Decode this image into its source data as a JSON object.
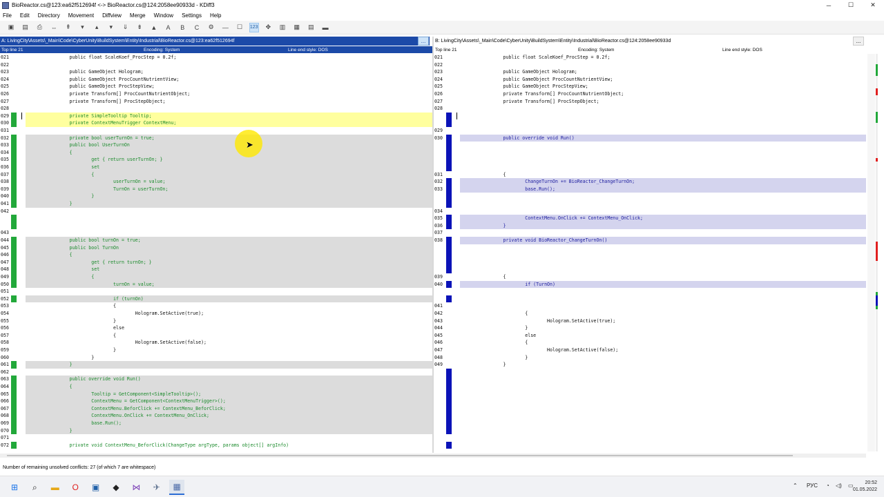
{
  "title": "BioReactor.cs@123:ea62f512694f <-> BioReactor.cs@124:2058ee90933d - KDiff3",
  "window_controls": {
    "minimize": "─",
    "maximize": "☐",
    "close": "✕"
  },
  "menu": [
    "File",
    "Edit",
    "Directory",
    "Movement",
    "Diffview",
    "Merge",
    "Window",
    "Settings",
    "Help"
  ],
  "toolbar_icons": [
    "open-icon",
    "save-icon",
    "print-icon",
    "goto-current-icon",
    "goto-first-delta-icon",
    "goto-prev-delta-icon",
    "goto-up-icon",
    "goto-down-icon",
    "goto-next-delta-icon",
    "goto-last-delta-icon",
    "goto-prev-conflict-icon",
    "goto-next-conflict-icon",
    "select-a-icon",
    "select-b-icon",
    "select-c-icon",
    "auto-merge-icon",
    "whitespace-icon",
    "line-numbers-icon",
    "show-windows-icon",
    "split-icon",
    "split-vertical-icon",
    "word-wrap-icon",
    "overview-icon"
  ],
  "toolbar_glyphs": [
    "▣",
    "▤",
    "⎙",
    "⇔",
    "⇞",
    "▾",
    "▴",
    "▾",
    "⇓",
    "⇟",
    "▲",
    "A",
    "B",
    "C",
    "⚙",
    "—",
    "☐",
    "123",
    "✥",
    "▥",
    "▦",
    "▤",
    "▬"
  ],
  "toolbar_selected": 17,
  "paneA": {
    "path": "A: LivingCity\\Assets\\_Main\\Code\\CyberUnity\\BuildSystem\\Entity\\Industrial\\BioReactor.cs@123:ea62f512694f",
    "browse": "...",
    "topline": "Top line 21",
    "encoding": "Encoding: System",
    "line_end": "Line end style: DOS",
    "lines": [
      {
        "n": "021",
        "t": "                public float ScaleKoef_ProcStep = 0.2f;"
      },
      {
        "n": "022",
        "t": ""
      },
      {
        "n": "023",
        "t": "                public GameObject Hologram;"
      },
      {
        "n": "024",
        "t": "                public GameObject ProcCountNutrientView;"
      },
      {
        "n": "025",
        "t": "                public GameObject ProcStepView;"
      },
      {
        "n": "026",
        "t": "                private Transform[] ProcCountNutrientObject;"
      },
      {
        "n": "027",
        "t": "                private Transform[] ProcStepObject;"
      },
      {
        "n": "028",
        "t": ""
      },
      {
        "n": "029",
        "t": "                private SimpleTooltip Tooltip;",
        "m": "g",
        "h": "y",
        "c": 1
      },
      {
        "n": "030",
        "t": "                private ContextMenuTrigger ContextMenu;",
        "m": "g",
        "h": "y",
        "c": 1
      },
      {
        "n": "031",
        "t": ""
      },
      {
        "n": "032",
        "t": "                private bool userTurnOn = true;",
        "m": "g",
        "h": "gr",
        "c": 1
      },
      {
        "n": "033",
        "t": "                public bool UserTurnOn",
        "m": "g",
        "h": "gr",
        "c": 1
      },
      {
        "n": "034",
        "t": "                {",
        "m": "g",
        "h": "gr",
        "c": 1
      },
      {
        "n": "035",
        "t": "                        get { return userTurnOn; }",
        "m": "g",
        "h": "gr",
        "c": 1
      },
      {
        "n": "036",
        "t": "                        set",
        "m": "g",
        "h": "gr",
        "c": 1
      },
      {
        "n": "037",
        "t": "                        {",
        "m": "g",
        "h": "gr",
        "c": 1
      },
      {
        "n": "038",
        "t": "                                userTurnOn = value;",
        "m": "g",
        "h": "gr",
        "c": 1
      },
      {
        "n": "039",
        "t": "                                TurnOn = userTurnOn;",
        "m": "g",
        "h": "gr",
        "c": 1
      },
      {
        "n": "040",
        "t": "                        }",
        "m": "g",
        "h": "gr",
        "c": 1
      },
      {
        "n": "041",
        "t": "                }",
        "m": "g",
        "h": "gr",
        "c": 1
      },
      {
        "n": "042",
        "t": ""
      },
      {
        "n": "",
        "t": "",
        "m": "g"
      },
      {
        "n": "",
        "t": "",
        "m": "g"
      },
      {
        "n": "043",
        "t": ""
      },
      {
        "n": "044",
        "t": "                public bool turnOn = true;",
        "m": "g",
        "h": "gr",
        "c": 1
      },
      {
        "n": "045",
        "t": "                public bool TurnOn",
        "m": "g",
        "h": "gr",
        "c": 1
      },
      {
        "n": "046",
        "t": "                {",
        "m": "g",
        "h": "gr",
        "c": 1
      },
      {
        "n": "047",
        "t": "                        get { return turnOn; }",
        "m": "g",
        "h": "gr",
        "c": 1
      },
      {
        "n": "048",
        "t": "                        set",
        "m": "g",
        "h": "gr",
        "c": 1
      },
      {
        "n": "049",
        "t": "                        {",
        "m": "g",
        "h": "gr",
        "c": 1
      },
      {
        "n": "050",
        "t": "                                turnOn = value;",
        "m": "g",
        "h": "gr",
        "c": 1
      },
      {
        "n": "051",
        "t": ""
      },
      {
        "n": "052",
        "t": "                                if (turnOn)",
        "m": "g",
        "h": "gr",
        "c": 1
      },
      {
        "n": "053",
        "t": "                                {"
      },
      {
        "n": "054",
        "t": "                                        Hologram.SetActive(true);"
      },
      {
        "n": "055",
        "t": "                                }"
      },
      {
        "n": "056",
        "t": "                                else"
      },
      {
        "n": "057",
        "t": "                                {"
      },
      {
        "n": "058",
        "t": "                                        Hologram.SetActive(false);"
      },
      {
        "n": "059",
        "t": "                                }"
      },
      {
        "n": "060",
        "t": "                        }"
      },
      {
        "n": "061",
        "t": "                }",
        "m": "g",
        "h": "gr",
        "c": 1
      },
      {
        "n": "062",
        "t": ""
      },
      {
        "n": "063",
        "t": "                public override void Run()",
        "m": "g",
        "h": "gr",
        "c": 1
      },
      {
        "n": "064",
        "t": "                {",
        "m": "g",
        "h": "gr",
        "c": 1
      },
      {
        "n": "065",
        "t": "                        Tooltip = GetComponent<SimpleTooltip>();",
        "m": "g",
        "h": "gr",
        "c": 1
      },
      {
        "n": "066",
        "t": "                        ContextMenu = GetComponent<ContextMenuTrigger>();",
        "m": "g",
        "h": "gr",
        "c": 1
      },
      {
        "n": "067",
        "t": "                        ContextMenu.BeforClick += ContextMenu_BeforClick;",
        "m": "g",
        "h": "gr",
        "c": 1
      },
      {
        "n": "068",
        "t": "                        ContextMenu.OnClick += ContextMenu_OnClick;",
        "m": "g",
        "h": "gr",
        "c": 1
      },
      {
        "n": "069",
        "t": "                        base.Run();",
        "m": "g",
        "h": "gr",
        "c": 1
      },
      {
        "n": "070",
        "t": "                }",
        "m": "g",
        "h": "gr",
        "c": 1
      },
      {
        "n": "071",
        "t": ""
      },
      {
        "n": "072",
        "t": "                private void ContextMenu_BeforClick(ChangeType argType, params object[] argInfo)",
        "m": "g",
        "c": 1
      }
    ]
  },
  "paneB": {
    "path": "B: LivingCity\\Assets\\_Main\\Code\\CyberUnity\\BuildSystem\\Entity\\Industrial\\BioReactor.cs@124:2058ee90933d",
    "browse": "...",
    "topline": "Top line 21",
    "encoding": "Encoding: System",
    "line_end": "Line end style: DOS",
    "lines": [
      {
        "n": "021",
        "t": "                public float ScaleKoef_ProcStep = 0.2f;"
      },
      {
        "n": "022",
        "t": ""
      },
      {
        "n": "023",
        "t": "                public GameObject Hologram;"
      },
      {
        "n": "024",
        "t": "                public GameObject ProcCountNutrientView;"
      },
      {
        "n": "025",
        "t": "                public GameObject ProcStepView;"
      },
      {
        "n": "026",
        "t": "                private Transform[] ProcCountNutrientObject;"
      },
      {
        "n": "027",
        "t": "                private Transform[] ProcStepObject;"
      },
      {
        "n": "028",
        "t": ""
      },
      {
        "n": "",
        "t": "",
        "m": "b"
      },
      {
        "n": "",
        "t": "",
        "m": "b"
      },
      {
        "n": "029",
        "t": ""
      },
      {
        "n": "030",
        "t": "                public override void Run()",
        "m": "b",
        "h": "lb",
        "c": 1
      },
      {
        "n": "",
        "t": "",
        "m": "b"
      },
      {
        "n": "",
        "t": "",
        "m": "b"
      },
      {
        "n": "",
        "t": "",
        "m": "b"
      },
      {
        "n": "",
        "t": "",
        "m": "b"
      },
      {
        "n": "031",
        "t": "                {"
      },
      {
        "n": "032",
        "t": "                        ChangeTurnOn += BioReactor_ChangeTurnOn;",
        "m": "b",
        "h": "lb",
        "c": 1
      },
      {
        "n": "033",
        "t": "                        base.Run();",
        "m": "b",
        "h": "lb",
        "c": 1
      },
      {
        "n": "",
        "t": "",
        "m": "b"
      },
      {
        "n": "",
        "t": "",
        "m": "b"
      },
      {
        "n": "034",
        "t": ""
      },
      {
        "n": "035",
        "t": "                        ContextMenu.OnClick += ContextMenu_OnClick;",
        "m": "b",
        "h": "lb",
        "c": 1
      },
      {
        "n": "036",
        "t": "                }",
        "m": "b",
        "h": "lb",
        "c": 1
      },
      {
        "n": "037",
        "t": ""
      },
      {
        "n": "038",
        "t": "                private void BioReactor_ChangeTurnOn()",
        "m": "b",
        "h": "lb",
        "c": 1
      },
      {
        "n": "",
        "t": "",
        "m": "b"
      },
      {
        "n": "",
        "t": "",
        "m": "b"
      },
      {
        "n": "",
        "t": "",
        "m": "b"
      },
      {
        "n": "",
        "t": "",
        "m": "b"
      },
      {
        "n": "039",
        "t": "                {"
      },
      {
        "n": "040",
        "t": "                        if (TurnOn)",
        "m": "b",
        "h": "lb",
        "c": 1
      },
      {
        "n": "",
        "t": ""
      },
      {
        "n": "",
        "t": "",
        "m": "b"
      },
      {
        "n": "041",
        "t": ""
      },
      {
        "n": "042",
        "t": "                        {"
      },
      {
        "n": "043",
        "t": "                                Hologram.SetActive(true);"
      },
      {
        "n": "044",
        "t": "                        }"
      },
      {
        "n": "045",
        "t": "                        else"
      },
      {
        "n": "046",
        "t": "                        {"
      },
      {
        "n": "047",
        "t": "                                Hologram.SetActive(false);"
      },
      {
        "n": "048",
        "t": "                        }"
      },
      {
        "n": "049",
        "t": "                }"
      },
      {
        "n": "",
        "t": "",
        "m": "b"
      },
      {
        "n": "",
        "t": "",
        "m": "b"
      },
      {
        "n": "",
        "t": "",
        "m": "b"
      },
      {
        "n": "",
        "t": "",
        "m": "b"
      },
      {
        "n": "",
        "t": "",
        "m": "b"
      },
      {
        "n": "",
        "t": "",
        "m": "b"
      },
      {
        "n": "",
        "t": "",
        "m": "b"
      },
      {
        "n": "",
        "t": "",
        "m": "b"
      },
      {
        "n": "",
        "t": "",
        "m": "b"
      },
      {
        "n": "",
        "t": ""
      },
      {
        "n": "",
        "t": "",
        "m": "b"
      }
    ]
  },
  "colors": {
    "accent": "#1c4aa8",
    "diff_green": "#22a83a",
    "diff_blue": "#0b13b8",
    "conflict_yellow": "#ffff9e",
    "delta_gray": "#dcdcdc",
    "delta_blue": "#d4d4ee",
    "overview_red": "#e02020"
  },
  "status": "Number of remaining unsolved conflicts: 27 (of which 7 are whitespace)",
  "taskbar": {
    "apps": [
      "start-icon",
      "search-icon",
      "file-explorer-icon",
      "opera-icon",
      "terminal-icon",
      "unity-icon",
      "visual-studio-icon",
      "tortoisehg-icon",
      "kdiff3-icon"
    ],
    "glyphs": [
      "⊞",
      "⌕",
      "▬",
      "O",
      "▣",
      "◆",
      "⋈",
      "✈",
      "▦"
    ],
    "tray": {
      "chevron": "⌃",
      "lang": "РУС",
      "wifi": "◔",
      "volume": "◁)",
      "battery": "▭"
    },
    "time": "20:52",
    "date": "01.05.2022"
  }
}
